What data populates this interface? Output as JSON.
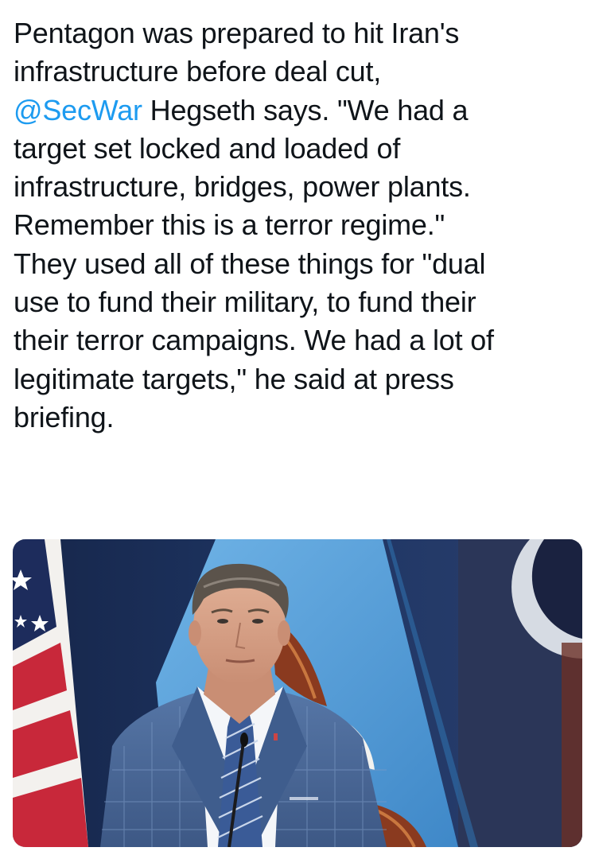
{
  "tweet": {
    "lines": [
      {
        "text": "Pentagon was prepared to hit Iran's"
      },
      {
        "text": "infrastructure before deal cut,"
      },
      {
        "mention": "@SecWar",
        "text": " Hegseth says. \"We had a"
      },
      {
        "text": "target set locked and loaded of"
      },
      {
        "text": "infrastructure, bridges, power plants."
      },
      {
        "text": "Remember this is a terror regime.\""
      },
      {
        "text": "They used all of these things for \"dual"
      },
      {
        "text": "use to fund their military, to fund their"
      },
      {
        "text": "their terror campaigns. We had a lot of"
      },
      {
        "text": "legitimate targets,\" he said at press"
      },
      {
        "text": "briefing."
      }
    ],
    "mention_color": "#1d9bf0"
  },
  "media": {
    "subject": "press-briefing-photo",
    "colors": {
      "backdrop_dark": "#1b2f57",
      "flag_light_blue": "#5aa3dc",
      "suit_blue": "#4a6b9a",
      "flag_red": "#c8283a"
    }
  }
}
